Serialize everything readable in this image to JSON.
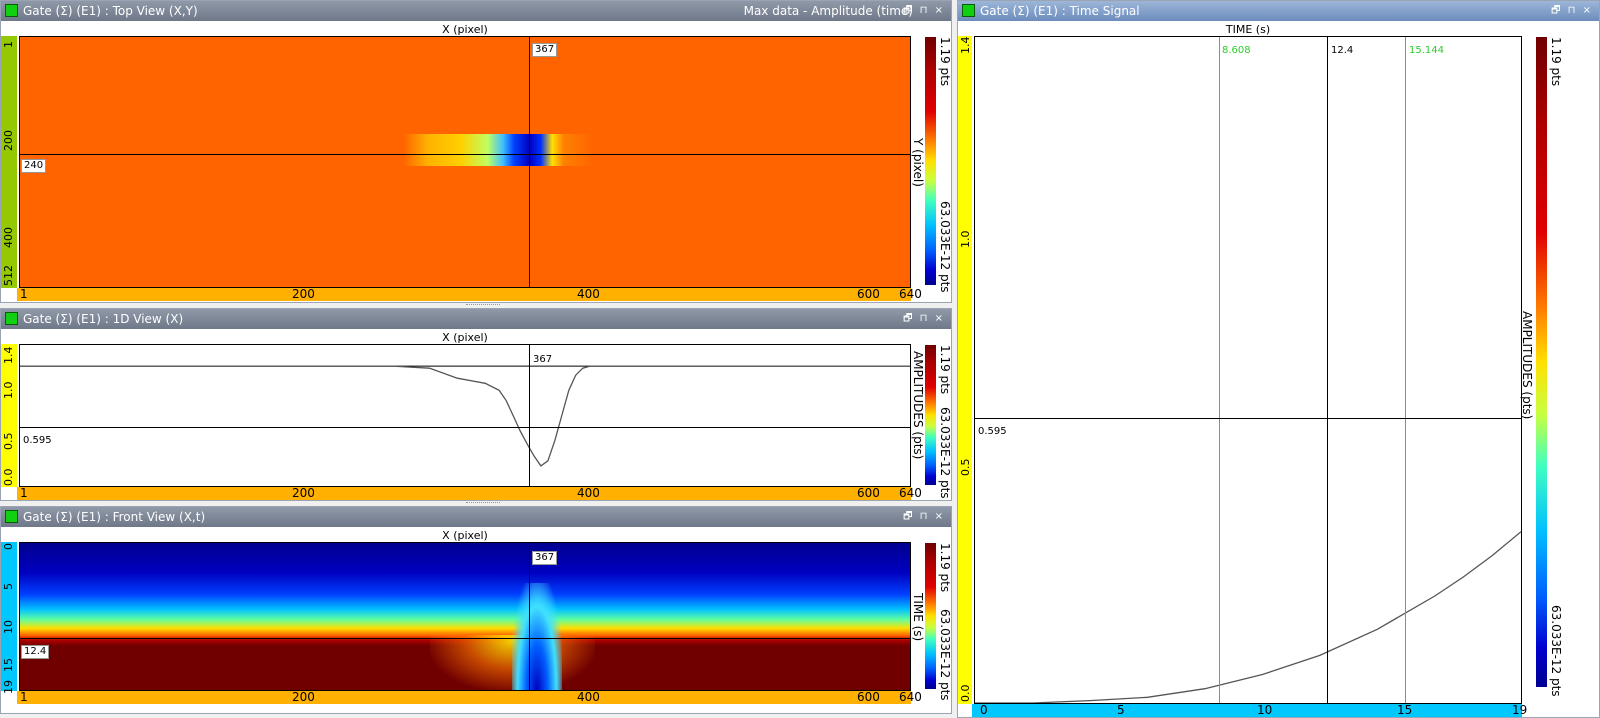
{
  "top_view": {
    "title": "Gate (Σ) (E1) : Top View (X,Y)",
    "right_title": "Max data - Amplitude (time)",
    "x_axis_title": "X (pixel)",
    "y_axis_title": "Y (pixel)",
    "x_ticks": [
      "1",
      "200",
      "400",
      "600",
      "640"
    ],
    "y_ticks": [
      "1",
      "200",
      "400",
      "512"
    ],
    "cursor_x": "367",
    "cursor_y": "240",
    "colorbar_max": "1.19 pts",
    "colorbar_min": "63.033E-12 pts"
  },
  "view_1d": {
    "title": "Gate (Σ) (E1) : 1D View (X)",
    "x_axis_title": "X (pixel)",
    "y_axis_title": "AMPLITUDES (pts)",
    "x_ticks": [
      "1",
      "200",
      "400",
      "600",
      "640"
    ],
    "y_ticks": [
      "0.0",
      "0.5",
      "1.0",
      "1.4"
    ],
    "cursor_x": "367",
    "cursor_y": "0.595",
    "colorbar_max": "1.19 pts",
    "colorbar_min": "63.033E-12 pts"
  },
  "front_view": {
    "title": "Gate (Σ) (E1) : Front View (X,t)",
    "x_axis_title": "X (pixel)",
    "y_axis_title": "TIME (s)",
    "x_ticks": [
      "1",
      "200",
      "400",
      "600",
      "640"
    ],
    "y_ticks": [
      "0",
      "5",
      "10",
      "15",
      "19"
    ],
    "cursor_x": "367",
    "cursor_y": "12.4",
    "colorbar_max": "1.19 pts",
    "colorbar_min": "63.033E-12 pts"
  },
  "time_signal": {
    "title": "Gate (Σ) (E1) : Time Signal",
    "x_axis_title": "TIME (s)",
    "y_axis_title": "AMPLITUDES (pts)",
    "x_ticks": [
      "0",
      "5",
      "10",
      "15",
      "19"
    ],
    "y_ticks": [
      "0.0",
      "0.5",
      "1.0",
      "1.4"
    ],
    "cursor_x": "12.4",
    "gate_start": "8.608",
    "gate_end": "15.144",
    "cursor_y": "0.595",
    "colorbar_max": "1.19 pts",
    "colorbar_min": "63.033E-12 pts"
  },
  "window_controls": "🗗 ⊓ ×",
  "chart_data": [
    {
      "type": "line",
      "title": "Gate (Σ) (E1) : 1D View (X)",
      "xlabel": "X (pixel)",
      "ylabel": "AMPLITUDES (pts)",
      "xlim": [
        1,
        640
      ],
      "ylim": [
        0,
        1.4
      ],
      "x": [
        1,
        270,
        295,
        315,
        335,
        345,
        350,
        355,
        360,
        365,
        370,
        375,
        380,
        385,
        390,
        395,
        400,
        405,
        410,
        640
      ],
      "y": [
        1.19,
        1.19,
        1.17,
        1.07,
        1.02,
        0.95,
        0.85,
        0.7,
        0.55,
        0.42,
        0.3,
        0.2,
        0.25,
        0.45,
        0.7,
        0.95,
        1.1,
        1.17,
        1.19,
        1.19
      ]
    },
    {
      "type": "line",
      "title": "Gate (Σ) (E1) : Time Signal",
      "xlabel": "TIME (s)",
      "ylabel": "AMPLITUDES (pts)",
      "xlim": [
        0,
        19
      ],
      "ylim": [
        0,
        1.4
      ],
      "x": [
        0,
        2,
        4,
        6,
        8,
        10,
        12,
        14,
        16,
        17,
        18,
        19
      ],
      "y": [
        0.0,
        0.0,
        0.005,
        0.012,
        0.03,
        0.06,
        0.1,
        0.155,
        0.225,
        0.265,
        0.31,
        0.36
      ]
    }
  ]
}
